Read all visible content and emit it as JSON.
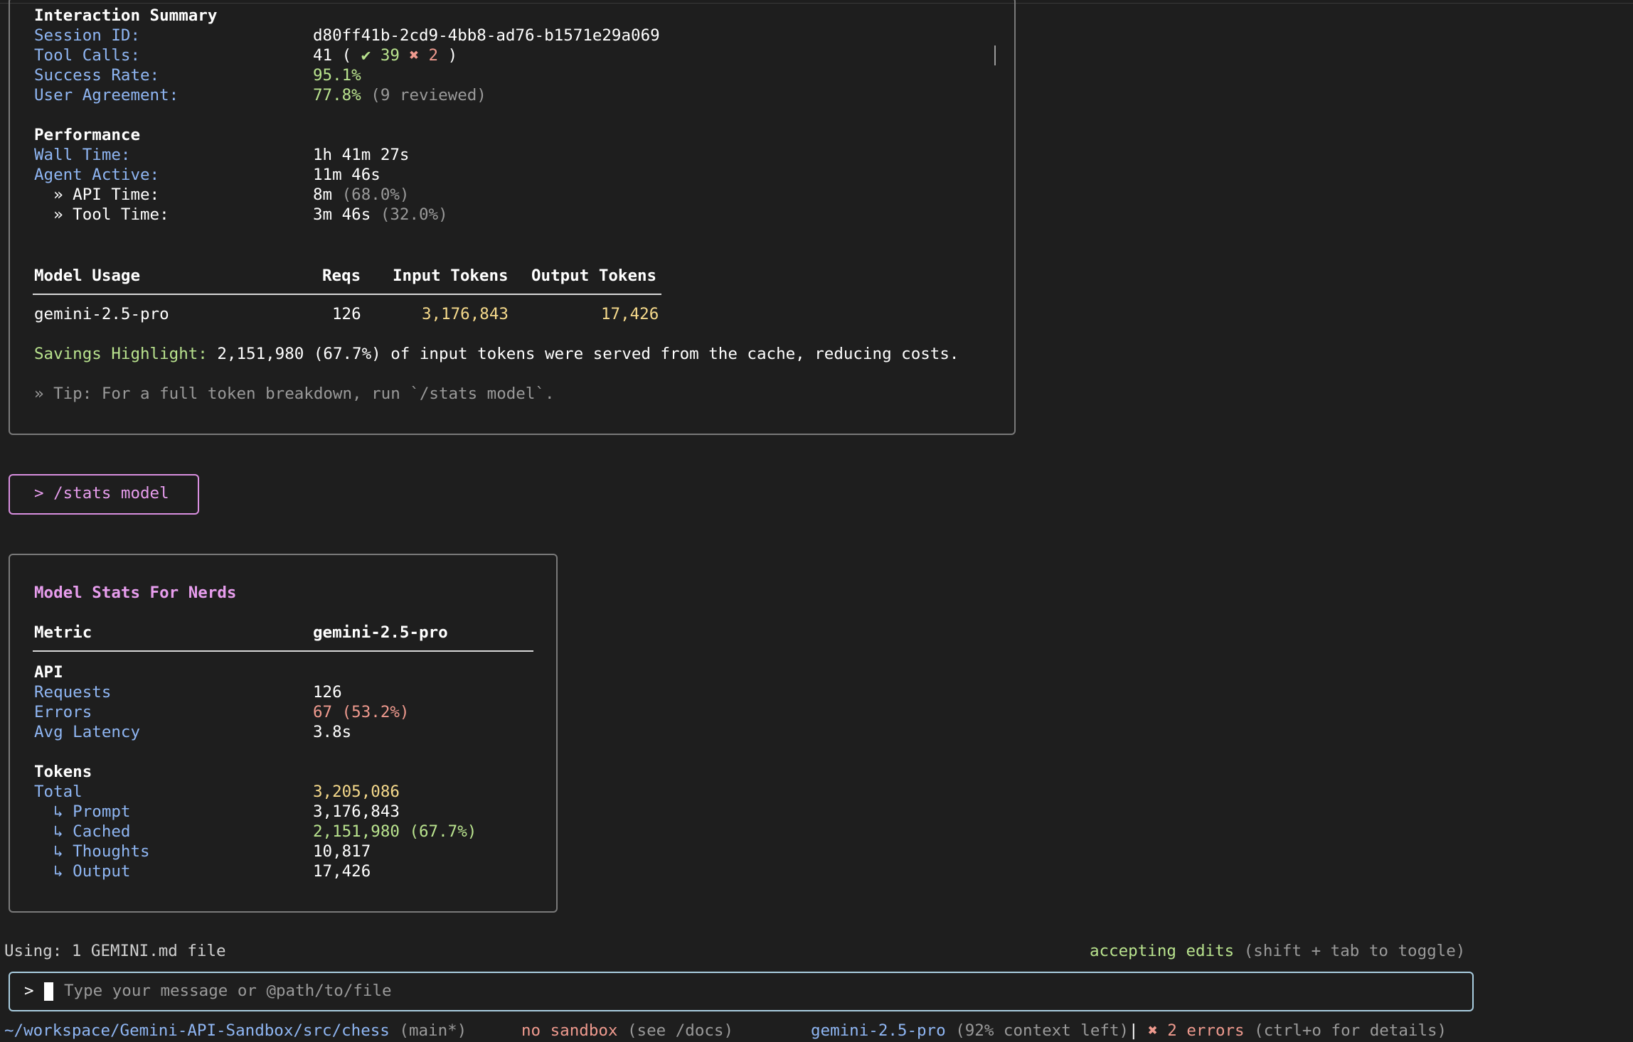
{
  "summary": {
    "title": "Interaction Summary",
    "session_label": "Session ID:",
    "session_value": "d80ff41b-2cd9-4bb8-ad76-b1571e29a069",
    "tool_calls_label": "Tool Calls:",
    "tool_calls_total": "41 ( ",
    "tool_calls_success": "✔ 39",
    "tool_calls_fail": "✖ 2",
    "tool_calls_close": " )",
    "success_rate_label": "Success Rate:",
    "success_rate_value": "95.1%",
    "agreement_label": "User Agreement:",
    "agreement_value": "77.8%",
    "agreement_note": " (9 reviewed)",
    "performance_title": "Performance",
    "wall_label": "Wall Time:",
    "wall_value": "1h 41m 27s",
    "agent_label": "Agent Active:",
    "agent_value": "11m 46s",
    "api_label": "  » API Time:",
    "api_value": "8m",
    "api_pct": " (68.0%)",
    "tool_label": "  » Tool Time:",
    "tool_value": "3m 46s",
    "tool_pct": " (32.0%)",
    "table": {
      "col_model": "Model Usage",
      "col_reqs": "Reqs",
      "col_input": "Input Tokens",
      "col_output": "Output Tokens",
      "row_model": "gemini-2.5-pro",
      "row_reqs": "126",
      "row_input": "3,176,843",
      "row_output": "17,426"
    },
    "savings_label": "Savings Highlight:",
    "savings_text": " 2,151,980 (67.7%) of input tokens were served from the cache, reducing costs.",
    "tip": "» Tip: For a full token breakdown, run `/stats model`."
  },
  "command": {
    "text": "> /stats model"
  },
  "model_stats": {
    "title": "Model Stats For Nerds",
    "col_metric": "Metric",
    "col_model": "gemini-2.5-pro",
    "api_section": "API",
    "requests_label": "Requests",
    "requests_value": "126",
    "errors_label": "Errors",
    "errors_value": "67 (53.2%)",
    "latency_label": "Avg Latency",
    "latency_value": "3.8s",
    "tokens_section": "Tokens",
    "total_label": "Total",
    "total_value": "3,205,086",
    "prompt_label": "  ↳ Prompt",
    "prompt_value": "3,176,843",
    "cached_label": "  ↳ Cached",
    "cached_value": "2,151,980 (67.7%)",
    "thoughts_label": "  ↳ Thoughts",
    "thoughts_value": "10,817",
    "output_label": "  ↳ Output",
    "output_value": "17,426"
  },
  "status": {
    "using": "Using: 1 GEMINI.md file",
    "accepting": "accepting edits",
    "accepting_hint": " (shift + tab to toggle)"
  },
  "input": {
    "prompt": ">",
    "placeholder": "Type your message or @path/to/file"
  },
  "footer": {
    "path": "~/workspace/Gemini-API-Sandbox/src/chess",
    "branch": " (main*)",
    "sandbox": "no sandbox",
    "sandbox_hint": " (see /docs)",
    "model": "gemini-2.5-pro",
    "context": " (92% context left)",
    "separator": "|",
    "errors": " ✖ 2 errors",
    "errors_hint": " (ctrl+o for details)"
  }
}
